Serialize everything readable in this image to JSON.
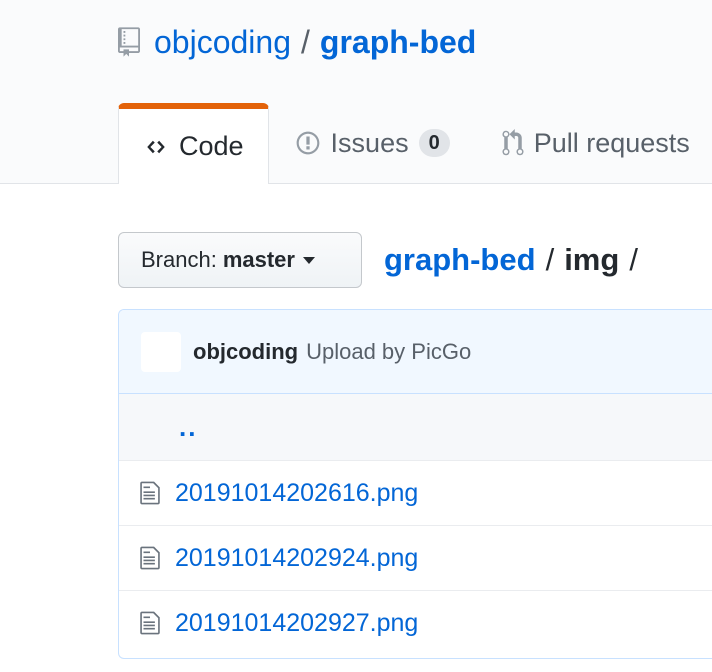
{
  "repo": {
    "owner": "objcoding",
    "separator": "/",
    "name": "graph-bed"
  },
  "tabs": [
    {
      "label": "Code",
      "icon": "code-icon",
      "selected": true
    },
    {
      "label": "Issues",
      "icon": "issue-opened-icon",
      "count": "0"
    },
    {
      "label": "Pull requests",
      "icon": "git-pull-request-icon"
    }
  ],
  "branch": {
    "label": "Branch:",
    "value": "master"
  },
  "breadcrumb": {
    "root": "graph-bed",
    "separator": "/",
    "current": "img",
    "trailing": "/"
  },
  "commit": {
    "author": "objcoding",
    "message": "Upload by PicGo"
  },
  "parent_link": "..",
  "files": [
    {
      "name": "20191014202616.png",
      "icon": "file-icon"
    },
    {
      "name": "20191014202924.png",
      "icon": "file-icon"
    },
    {
      "name": "20191014202927.png",
      "icon": "file-icon"
    }
  ],
  "colors": {
    "link": "#0366d6",
    "accent_tab": "#e36209",
    "header_bg": "#fafbfc"
  }
}
